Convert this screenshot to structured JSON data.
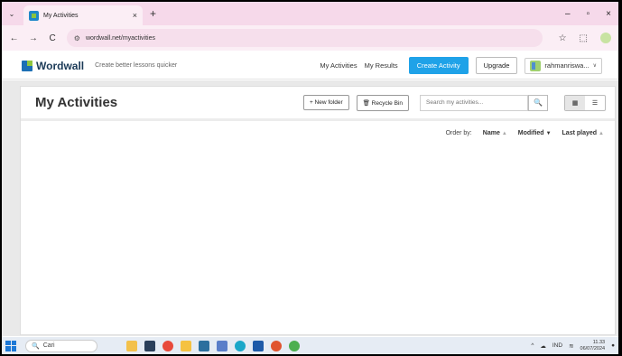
{
  "browser": {
    "tab_menu_icon": "chevron-down-icon",
    "tab_title": "My Activities",
    "tab_close": "×",
    "new_tab": "+",
    "win_min": "–",
    "win_max": "▫",
    "win_close": "×",
    "back": "←",
    "forward": "→",
    "reload": "C",
    "url": "wordwall.net/myactivities"
  },
  "header": {
    "logo_text": "Wordwall",
    "tagline": "Create better lessons quicker",
    "links": [
      "My Activities",
      "My Results"
    ],
    "create_label": "Create Activity",
    "upgrade_label": "Upgrade",
    "user_name": "rahmanriswa...",
    "user_chevron": "∨"
  },
  "page": {
    "title": "My Activities",
    "new_folder_label": "+ New folder",
    "recycle_bin_label": "🗑 Recycle Bin",
    "search_placeholder": "Search my activities...",
    "order_label": "Order by:",
    "order_items": [
      {
        "label": "Name",
        "arrow": "▲"
      },
      {
        "label": "Modified",
        "arrow": "▼"
      },
      {
        "label": "Last played",
        "arrow": "▲"
      }
    ]
  },
  "taskbar": {
    "search_label": "Cari",
    "lang": "IND",
    "time": "11.33",
    "date": "06/07/2024"
  },
  "colors": {
    "accent": "#1fa2e8",
    "tab_strip": "#f6d9ea"
  }
}
